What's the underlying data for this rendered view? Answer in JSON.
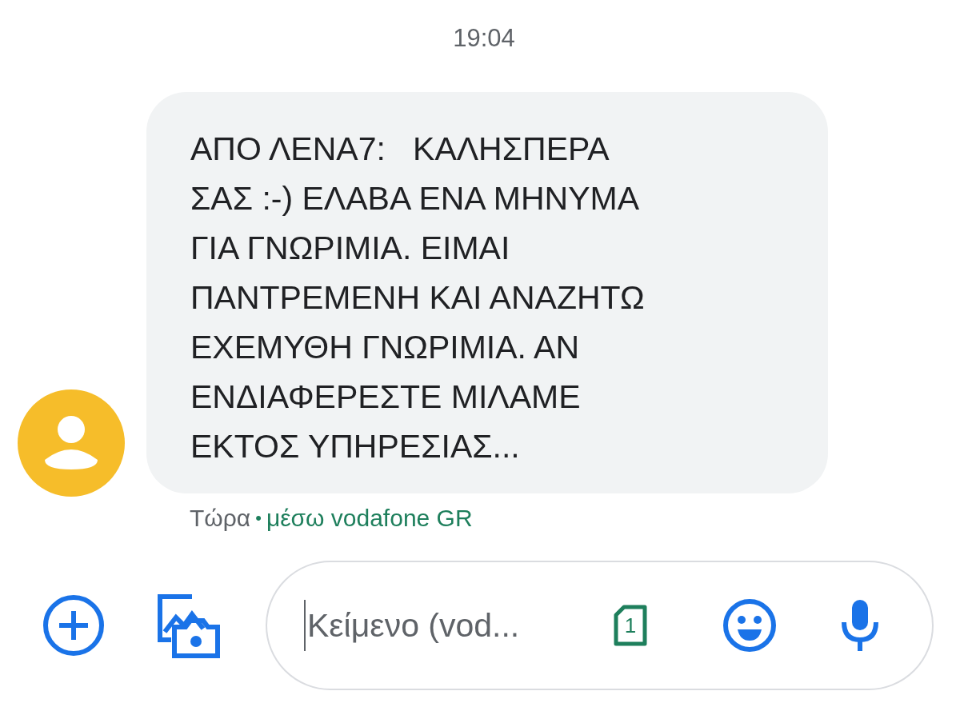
{
  "timestamp": "19:04",
  "message": {
    "text": "ΑΠΟ ΛΕΝΑ7:   ΚΑΛΗΣΠΕΡΑ\nΣΑΣ :-) ΕΛΑΒΑ ΕΝΑ ΜΗΝΥΜΑ\nΓΙΑ ΓΝΩΡΙΜΙΑ. ΕΙΜΑΙ\nΠΑΝΤΡΕΜΕΝΗ ΚΑΙ ΑΝΑΖΗΤΩ\nΕΧΕΜΥΘΗ ΓΝΩΡΙΜΙΑ. ΑΝ\nΕΝΔΙΑΦΕΡΕΣΤΕ ΜΙΛΑΜΕ\nΕΚΤΟΣ ΥΠΗΡΕΣΙΑΣ...",
    "time": "Τώρα",
    "separator": "•",
    "via": "μέσω vodafone GR"
  },
  "composer": {
    "placeholder": "Κείμενο (vod...",
    "sim_label": "1"
  }
}
